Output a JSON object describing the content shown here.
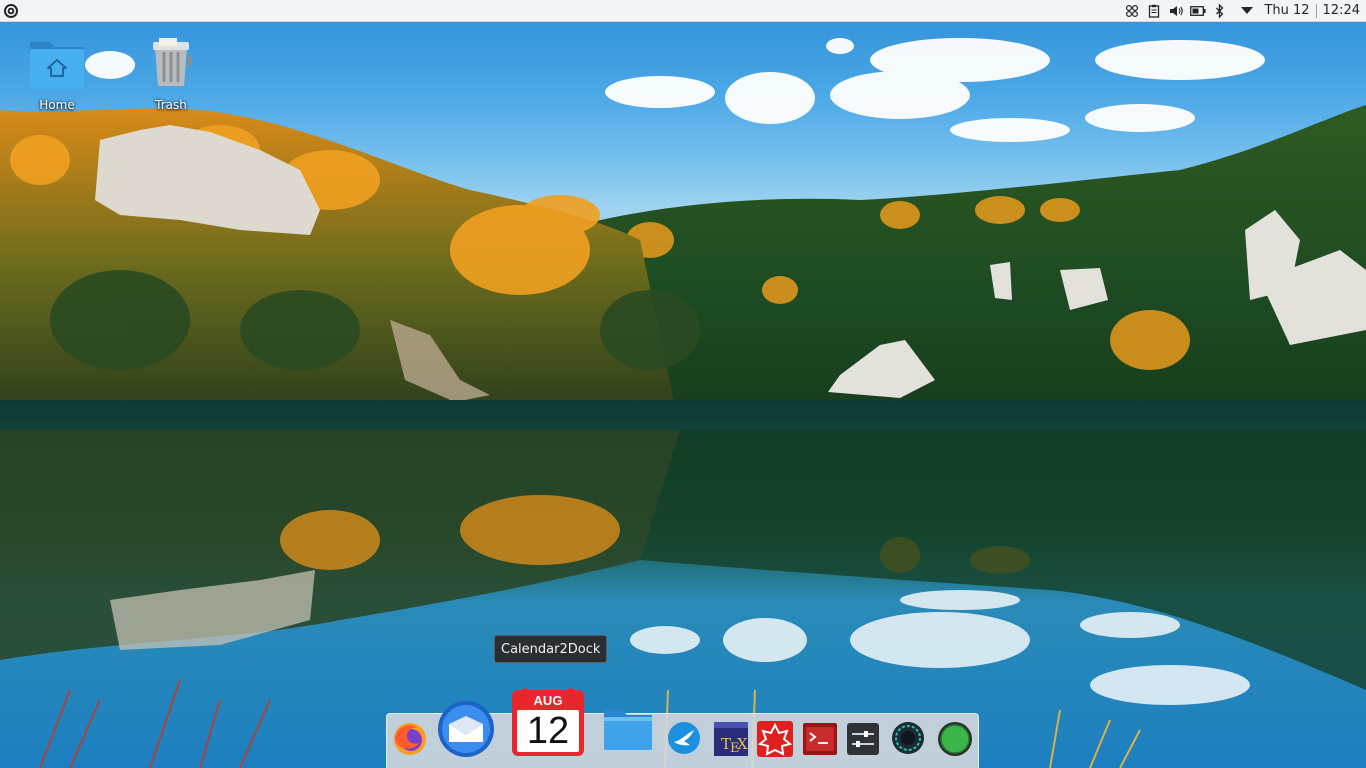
{
  "top_panel": {
    "launcher_icon": "kde-logo-icon",
    "tray_icons": [
      "network-icon",
      "clipboard-icon",
      "volume-icon",
      "battery-icon",
      "bluetooth-icon",
      "expand-tray-icon"
    ],
    "date": "Thu 12",
    "time": "12:24"
  },
  "desktop": {
    "icons": [
      {
        "label": "Home",
        "icon": "home-folder-icon"
      },
      {
        "label": "Trash",
        "icon": "trash-icon"
      }
    ]
  },
  "tooltip": {
    "text": "Calendar2Dock"
  },
  "dock": {
    "items": [
      {
        "name": "firefox",
        "icon": "firefox-icon"
      },
      {
        "name": "thunderbird",
        "icon": "thunderbird-icon"
      },
      {
        "name": "calendar2dock",
        "icon": "calendar-icon",
        "month": "AUG",
        "day": "12"
      },
      {
        "name": "files",
        "icon": "folder-icon"
      },
      {
        "name": "kdeconnect",
        "icon": "swift-bird-icon"
      },
      {
        "name": "texstudio",
        "icon": "tex-icon"
      },
      {
        "name": "wolfram",
        "icon": "wolfram-icon"
      },
      {
        "name": "terminal",
        "icon": "terminal-icon"
      },
      {
        "name": "system-settings",
        "icon": "settings-sliders-icon"
      },
      {
        "name": "system-monitor",
        "icon": "monitor-dial-icon"
      },
      {
        "name": "status",
        "icon": "green-circle-icon"
      }
    ]
  },
  "colors": {
    "panel_bg": "#f2f4f6",
    "calendar_red": "#e8262b",
    "folder_blue": "#3ea3e8"
  }
}
